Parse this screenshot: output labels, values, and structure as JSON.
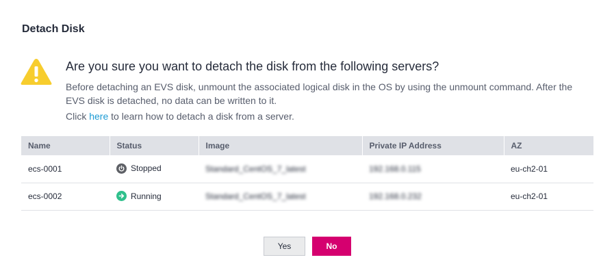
{
  "dialog": {
    "title": "Detach Disk",
    "question": "Are you sure you want to detach the disk from the following servers?",
    "description": "Before detaching an EVS disk, unmount the associated logical disk in the OS by using the unmount command. After the EVS disk is detached, no data can be written to it.",
    "help_prefix": "Click ",
    "help_link": "here",
    "help_suffix": " to learn how to detach a disk from a server.",
    "warning_icon": "warning-triangle-icon",
    "colors": {
      "warning": "#f7cd2e",
      "link": "#1d9bd4",
      "primary": "#d5006f"
    }
  },
  "table": {
    "columns": [
      "Name",
      "Status",
      "Image",
      "Private IP Address",
      "AZ"
    ],
    "rows": [
      {
        "name": "ecs-0001",
        "status": "Stopped",
        "status_icon": "power-icon",
        "image": "Standard_CentOS_7_latest",
        "ip": "192.168.0.115",
        "az": "eu-ch2-01"
      },
      {
        "name": "ecs-0002",
        "status": "Running",
        "status_icon": "arrow-right-circle-icon",
        "image": "Standard_CentOS_7_latest",
        "ip": "192.168.0.232",
        "az": "eu-ch2-01"
      }
    ]
  },
  "buttons": {
    "yes": "Yes",
    "no": "No"
  }
}
